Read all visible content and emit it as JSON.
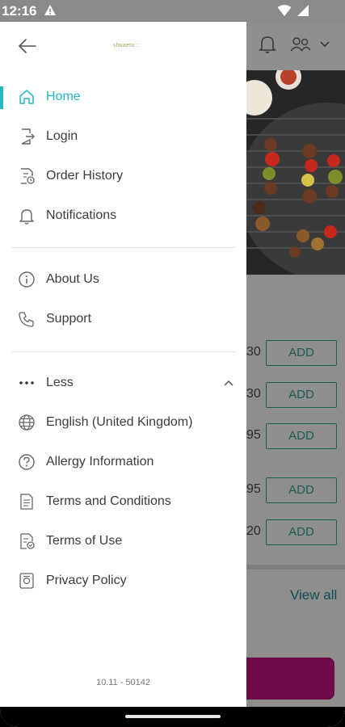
{
  "status_bar": {
    "time": "12:16",
    "left_icon": "warning-icon",
    "right_icons": [
      "wifi-icon",
      "signal-icon"
    ]
  },
  "background_app": {
    "header_icons": [
      "bell-icon",
      "people-icon",
      "chevron-down-icon"
    ],
    "price_rows": [
      {
        "price_fragment": "30",
        "add_label": "ADD"
      },
      {
        "price_fragment": "30",
        "add_label": "ADD"
      },
      {
        "price_fragment": "95",
        "add_label": "ADD"
      },
      {
        "price_fragment": "95",
        "add_label": "ADD"
      },
      {
        "price_fragment": "20",
        "add_label": "ADD"
      }
    ],
    "view_all_label": "View all"
  },
  "drawer": {
    "back_icon": "arrow-left-icon",
    "brand_text": "shuaeto ::",
    "primary_items": [
      {
        "label": "Home",
        "icon": "home-icon",
        "active": true
      },
      {
        "label": "Login",
        "icon": "login-icon",
        "active": false
      },
      {
        "label": "Order History",
        "icon": "order-history-icon",
        "active": false
      },
      {
        "label": "Notifications",
        "icon": "bell-icon",
        "active": false
      }
    ],
    "secondary_items": [
      {
        "label": "About Us",
        "icon": "info-icon"
      },
      {
        "label": "Support",
        "icon": "phone-icon"
      }
    ],
    "less_item": {
      "label": "Less",
      "icon": "more-dots-icon",
      "chevron": "chevron-up-icon"
    },
    "extra_items": [
      {
        "label": "English (United Kingdom)",
        "icon": "globe-icon"
      },
      {
        "label": "Allergy Information",
        "icon": "question-icon"
      },
      {
        "label": "Terms and Conditions",
        "icon": "document-icon"
      },
      {
        "label": "Terms of Use",
        "icon": "document-check-icon"
      },
      {
        "label": "Privacy Policy",
        "icon": "privacy-icon"
      }
    ],
    "version": "10.11 - 50142"
  },
  "colors": {
    "accent": "#23b7c3",
    "text": "#3c3c3c",
    "add_button": "#1d5e54",
    "cta": "#6f0a47"
  }
}
